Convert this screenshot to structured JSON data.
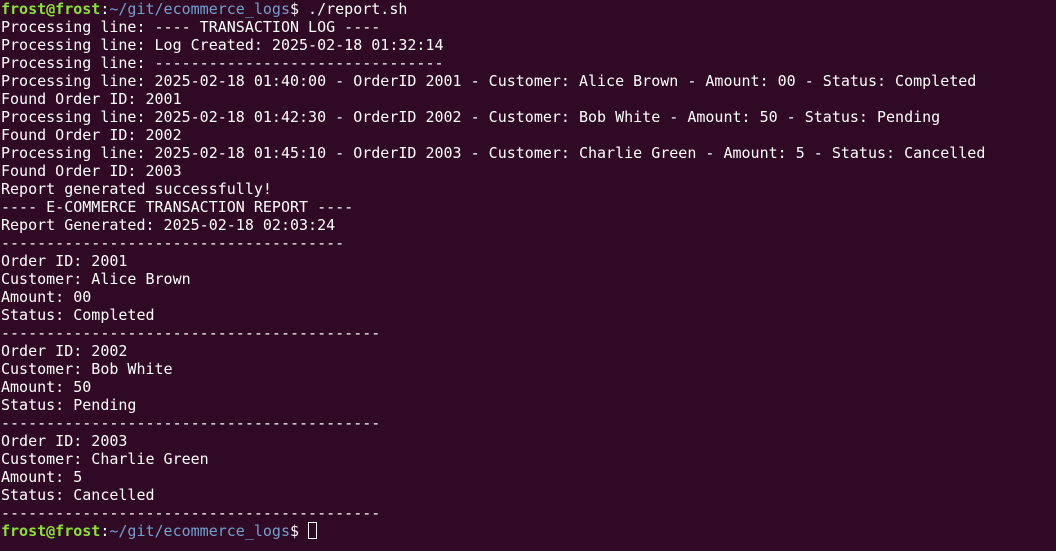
{
  "prompt": {
    "user_host": "frost@frost",
    "colon": ":",
    "path": "~/git/ecommerce_logs",
    "dollar": "$",
    "command": " ./report.sh"
  },
  "output_lines": [
    "Processing line: ---- TRANSACTION LOG ----",
    "Processing line: Log Created: 2025-02-18 01:32:14",
    "Processing line: --------------------------------",
    "Processing line: 2025-02-18 01:40:00 - OrderID 2001 - Customer: Alice Brown - Amount: 00 - Status: Completed",
    "Found Order ID: 2001",
    "Processing line: 2025-02-18 01:42:30 - OrderID 2002 - Customer: Bob White - Amount: 50 - Status: Pending",
    "Found Order ID: 2002",
    "Processing line: 2025-02-18 01:45:10 - OrderID 2003 - Customer: Charlie Green - Amount: 5 - Status: Cancelled",
    "Found Order ID: 2003",
    "Report generated successfully!",
    "---- E-COMMERCE TRANSACTION REPORT ----",
    "Report Generated: 2025-02-18 02:03:24",
    "--------------------------------------",
    "Order ID: 2001",
    "Customer: Alice Brown",
    "Amount: 00",
    "Status: Completed",
    "------------------------------------------",
    "Order ID: 2002",
    "Customer: Bob White",
    "Amount: 50",
    "Status: Pending",
    "------------------------------------------",
    "Order ID: 2003",
    "Customer: Charlie Green",
    "Amount: 5",
    "Status: Cancelled",
    "------------------------------------------"
  ],
  "final_prompt": {
    "user_host": "frost@frost",
    "colon": ":",
    "path": "~/git/ecommerce_logs",
    "dollar": "$",
    "command": " "
  },
  "colors": {
    "background": "#300a24",
    "text": "#ffffff",
    "user_host": "#8ae234",
    "path": "#729fcf"
  }
}
